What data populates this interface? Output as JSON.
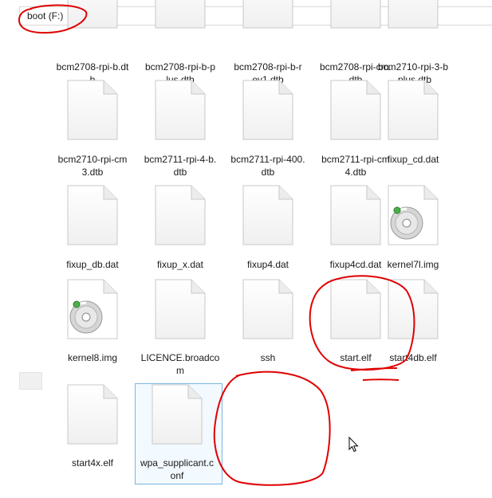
{
  "breadcrumb": {
    "drive": "boot (F:)",
    "chevron_icon": "chevron-right-icon"
  },
  "files": [
    {
      "id": "f0",
      "name": "bcm2708-rpi-b.dtb",
      "line1": "bcm2708-rpi-b.dt",
      "line2": "b",
      "icon": "document-icon"
    },
    {
      "id": "f1",
      "name": "bcm2708-rpi-b-plus.dtb",
      "line1": "bcm2708-rpi-b-p",
      "line2": "lus.dtb",
      "icon": "document-icon"
    },
    {
      "id": "f2",
      "name": "bcm2708-rpi-b-rev1.dtb",
      "line1": "bcm2708-rpi-b-r",
      "line2": "ev1.dtb",
      "icon": "document-icon"
    },
    {
      "id": "f3",
      "name": "bcm2708-rpi-cm.dtb",
      "line1": "bcm2708-rpi-cm.",
      "line2": "dtb",
      "icon": "document-icon"
    },
    {
      "id": "f4",
      "name": "bcm2710-rpi-3-b-plus.dtb",
      "line1": "bcm2710-rpi-3-b",
      "line2": "-plus.dtb",
      "icon": "document-icon"
    },
    {
      "id": "f5",
      "name": "bcm2710-rpi-cm3.dtb",
      "line1": "bcm2710-rpi-cm",
      "line2": "3.dtb",
      "icon": "document-icon"
    },
    {
      "id": "f6",
      "name": "bcm2711-rpi-4-b.dtb",
      "line1": "bcm2711-rpi-4-b.",
      "line2": "dtb",
      "icon": "document-icon"
    },
    {
      "id": "f7",
      "name": "bcm2711-rpi-400.dtb",
      "line1": "bcm2711-rpi-400.",
      "line2": "dtb",
      "icon": "document-icon"
    },
    {
      "id": "f8",
      "name": "bcm2711-rpi-cm4.dtb",
      "line1": "bcm2711-rpi-cm",
      "line2": "4.dtb",
      "icon": "document-icon"
    },
    {
      "id": "f9",
      "name": "fixup_cd.dat",
      "line1": "fixup_cd.dat",
      "line2": "",
      "icon": "document-icon"
    },
    {
      "id": "f10",
      "name": "fixup_db.dat",
      "line1": "fixup_db.dat",
      "line2": "",
      "icon": "document-icon"
    },
    {
      "id": "f11",
      "name": "fixup_x.dat",
      "line1": "fixup_x.dat",
      "line2": "",
      "icon": "document-icon"
    },
    {
      "id": "f12",
      "name": "fixup4.dat",
      "line1": "fixup4.dat",
      "line2": "",
      "icon": "document-icon"
    },
    {
      "id": "f13",
      "name": "fixup4cd.dat",
      "line1": "fixup4cd.dat",
      "line2": "",
      "icon": "document-icon"
    },
    {
      "id": "f14",
      "name": "kernel7l.img",
      "line1": "kernel7l.img",
      "line2": "",
      "icon": "disc-image-icon"
    },
    {
      "id": "f15",
      "name": "kernel8.img",
      "line1": "kernel8.img",
      "line2": "",
      "icon": "disc-image-icon"
    },
    {
      "id": "f16",
      "name": "LICENCE.broadcom",
      "line1": "LICENCE.broadco",
      "line2": "m",
      "icon": "document-icon"
    },
    {
      "id": "f17",
      "name": "ssh",
      "line1": "ssh",
      "line2": "",
      "icon": "document-icon"
    },
    {
      "id": "f18",
      "name": "start.elf",
      "line1": "start.elf",
      "line2": "",
      "icon": "document-icon"
    },
    {
      "id": "f19",
      "name": "start4db.elf",
      "line1": "start4db.elf",
      "line2": "",
      "icon": "document-icon"
    },
    {
      "id": "f20",
      "name": "start4x.elf",
      "line1": "start4x.elf",
      "line2": "",
      "icon": "document-icon"
    },
    {
      "id": "f21",
      "name": "wpa_supplicant.conf",
      "line1": "wpa_supplicant.c",
      "line2": "onf",
      "icon": "document-icon",
      "selected": true
    }
  ],
  "colors": {
    "annotation": "#e00000",
    "selection_border": "#7ab7df"
  },
  "cursor_icon": "mouse-pointer-icon"
}
